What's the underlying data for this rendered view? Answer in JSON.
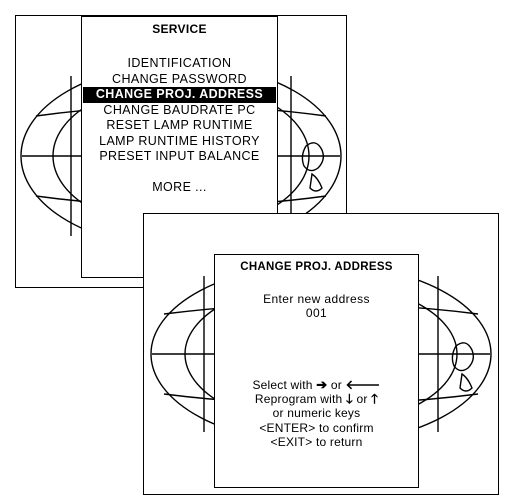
{
  "service_menu": {
    "title": "SERVICE",
    "items": [
      {
        "label": "IDENTIFICATION",
        "selected": false
      },
      {
        "label": "CHANGE PASSWORD",
        "selected": false
      },
      {
        "label": "CHANGE PROJ. ADDRESS",
        "selected": true
      },
      {
        "label": "CHANGE BAUDRATE PC",
        "selected": false
      },
      {
        "label": "RESET LAMP RUNTIME",
        "selected": false
      },
      {
        "label": "LAMP RUNTIME HISTORY",
        "selected": false
      },
      {
        "label": "PRESET INPUT BALANCE",
        "selected": false
      }
    ],
    "more_label": "MORE ..."
  },
  "address_dialog": {
    "title": "CHANGE PROJ. ADDRESS",
    "prompt": "Enter new address",
    "value": "001",
    "instructions": {
      "select_prefix": "Select with",
      "arrow_right": "➔",
      "or_1": "or",
      "arrow_left": "🡐",
      "reprogram_prefix": "Reprogram with",
      "arrow_down": "🡓",
      "or_2": "or",
      "arrow_up": "🡑",
      "numeric": "or numeric keys",
      "confirm": "<ENTER> to confirm",
      "return": "<EXIT> to return"
    }
  }
}
